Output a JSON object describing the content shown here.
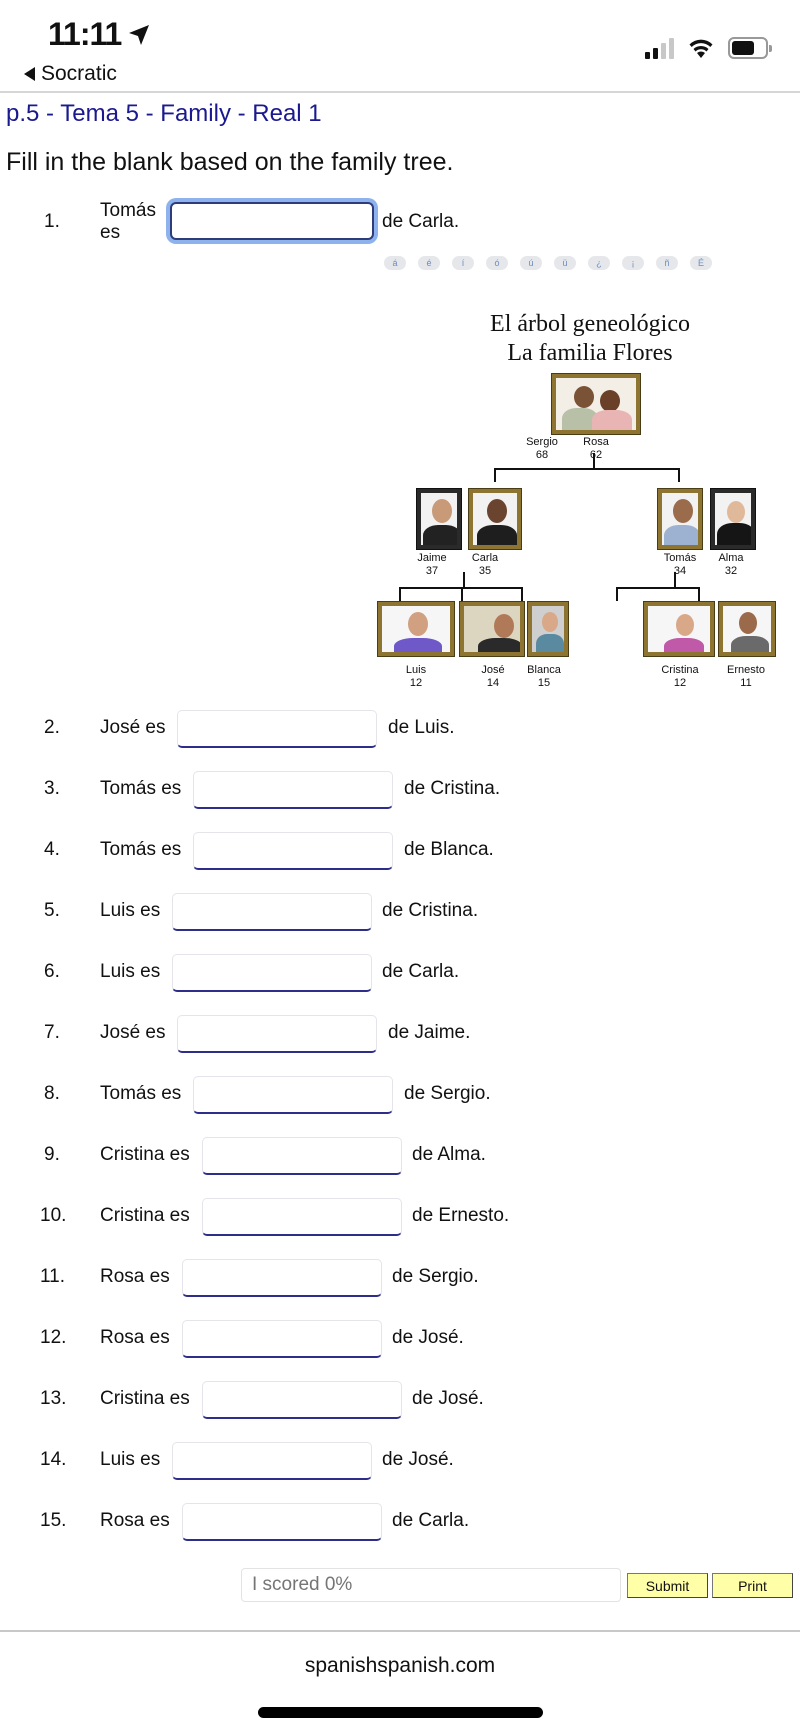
{
  "status_bar": {
    "time": "11:11",
    "back_label": "Socratic",
    "icons": [
      "location-arrow-icon",
      "cellular-signal-icon",
      "wifi-icon",
      "battery-icon"
    ]
  },
  "page": {
    "title": "p.5 - Tema 5 - Family - Real 1",
    "instructions": "Fill in the blank based on the family tree."
  },
  "accent_buttons": [
    "á",
    "é",
    "í",
    "ó",
    "ú",
    "ü",
    "¿",
    "¡",
    "ñ",
    "É"
  ],
  "family_tree": {
    "title_line1": "El árbol geneológico",
    "title_line2": "La familia Flores",
    "grandparents": [
      {
        "name": "Sergio",
        "age": "68"
      },
      {
        "name": "Rosa",
        "age": "62"
      }
    ],
    "left_parents": [
      {
        "name": "Jaime",
        "age": "37"
      },
      {
        "name": "Carla",
        "age": "35"
      }
    ],
    "right_parents": [
      {
        "name": "Tomás",
        "age": "34"
      },
      {
        "name": "Alma",
        "age": "32"
      }
    ],
    "left_children": [
      {
        "name": "Luis",
        "age": "12"
      },
      {
        "name": "José",
        "age": "14"
      },
      {
        "name": "Blanca",
        "age": "15"
      }
    ],
    "right_children": [
      {
        "name": "Cristina",
        "age": "12"
      },
      {
        "name": "Ernesto",
        "age": "11"
      }
    ]
  },
  "questions": [
    {
      "num": "1.",
      "lead": "Tomás es",
      "tail": "de Carla.",
      "value": ""
    },
    {
      "num": "2.",
      "lead": "José es",
      "tail": "de Luis.",
      "value": ""
    },
    {
      "num": "3.",
      "lead": "Tomás es",
      "tail": "de Cristina.",
      "value": ""
    },
    {
      "num": "4.",
      "lead": "Tomás es",
      "tail": "de Blanca.",
      "value": ""
    },
    {
      "num": "5.",
      "lead": "Luis es",
      "tail": "de Cristina.",
      "value": ""
    },
    {
      "num": "6.",
      "lead": "Luis es",
      "tail": "de Carla.",
      "value": ""
    },
    {
      "num": "7.",
      "lead": "José es",
      "tail": "de Jaime.",
      "value": ""
    },
    {
      "num": "8.",
      "lead": "Tomás es",
      "tail": "de Sergio.",
      "value": ""
    },
    {
      "num": "9.",
      "lead": "Cristina es",
      "tail": "de Alma.",
      "value": ""
    },
    {
      "num": "10.",
      "lead": "Cristina es",
      "tail": "de Ernesto.",
      "value": ""
    },
    {
      "num": "11.",
      "lead": "Rosa es",
      "tail": "de Sergio.",
      "value": ""
    },
    {
      "num": "12.",
      "lead": "Rosa es",
      "tail": "de José.",
      "value": ""
    },
    {
      "num": "13.",
      "lead": "Cristina es",
      "tail": "de José.",
      "value": ""
    },
    {
      "num": "14.",
      "lead": "Luis es",
      "tail": "de José.",
      "value": ""
    },
    {
      "num": "15.",
      "lead": "Rosa es",
      "tail": "de Carla.",
      "value": ""
    }
  ],
  "score": {
    "value": "",
    "placeholder": "I scored 0%"
  },
  "buttons": {
    "submit": "Submit",
    "print": "Print"
  },
  "footer": {
    "site": "spanishspanish.com"
  }
}
